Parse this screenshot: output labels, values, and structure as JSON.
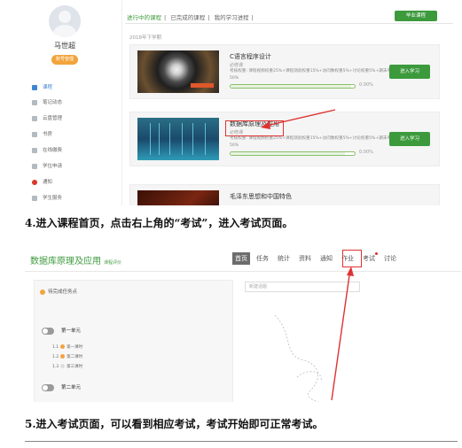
{
  "shot1": {
    "user_name": "马世超",
    "profile_button": "账号管理",
    "nav": [
      {
        "label": "课程"
      },
      {
        "label": "笔记动态"
      },
      {
        "label": "云盘管理"
      },
      {
        "label": "书房"
      },
      {
        "label": "在线缴费"
      },
      {
        "label": "学位申请"
      },
      {
        "label": "通知"
      },
      {
        "label": "学生服务"
      }
    ],
    "tabs": [
      "进行中的课程",
      "|",
      "已完成的课程",
      "|",
      "我的学习进程",
      "|"
    ],
    "graduate_button": "毕业课程",
    "term": "2018年下学期",
    "courses": [
      {
        "title": "C语言程序设计",
        "type": "必修课",
        "weights": "考核权重: 课程视频权重25%+课程测验权重15%+访问数权重5%+讨论权重5%+期末考试权重50%",
        "progress_pct": 97,
        "progress_label": "0.00%",
        "button": "进入学习"
      },
      {
        "title": "数据库原理及应用",
        "type": "必修课",
        "weights": "考核权重: 课程视频权重25%+课程测验权重15%+访问数权重5%+讨论权重5%+期末考试权重50%",
        "progress_pct": 92,
        "progress_label": "0.00%",
        "button": "进入学习"
      },
      {
        "title": "毛泽东思想和中国特色"
      }
    ]
  },
  "caption1": "4.进入课程首页，点击右上角的“考试”，进入考试页面。",
  "shot2": {
    "course_title": "数据库原理及应用",
    "course_sub": "课程评价",
    "tabs": [
      "首页",
      "任务",
      "统计",
      "资料",
      "通知",
      "作业",
      "考试",
      "讨论"
    ],
    "pending": "待完成任务点",
    "units": [
      {
        "label": "第一单元",
        "lessons": [
          {
            "num": "1.1",
            "label": "第一课时"
          },
          {
            "num": "1.2",
            "label": "第二课时"
          },
          {
            "num": "1.3",
            "label": "第三课时"
          }
        ]
      },
      {
        "label": "第二单元"
      }
    ],
    "search_placeholder": "新建话题"
  },
  "caption2": "5.进入考试页面，可以看到相应考试，考试开始即可正常考试。",
  "colors": {
    "green": "#3c9a3c",
    "orange": "#f2a43c",
    "red": "#e03131",
    "blue": "#3f86d1"
  }
}
